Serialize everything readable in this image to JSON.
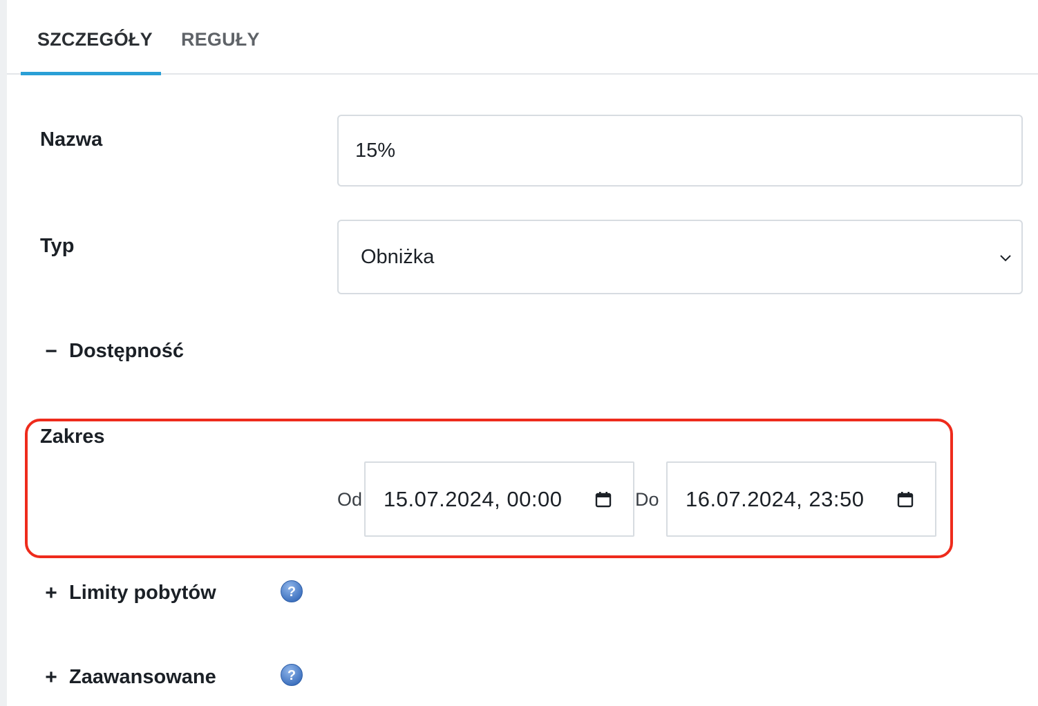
{
  "tabs": [
    {
      "label": "SZCZEGÓŁY",
      "active": true
    },
    {
      "label": "REGUŁY",
      "active": false
    }
  ],
  "form": {
    "name": {
      "label": "Nazwa",
      "value": "15%"
    },
    "type": {
      "label": "Typ",
      "value": "Obniżka"
    },
    "availability": {
      "toggle": "−",
      "title": "Dostępność",
      "expanded": true
    },
    "range": {
      "label": "Zakres",
      "from_label": "Od",
      "from_value": "15.07.2024, 00:00",
      "to_label": "Do",
      "to_value": "16.07.2024, 23:50"
    },
    "stay_limits": {
      "toggle": "+",
      "title": "Limity pobytów",
      "expanded": false
    },
    "advanced": {
      "toggle": "+",
      "title": "Zaawansowane",
      "expanded": false
    }
  },
  "colors": {
    "accent": "#2a9fd6",
    "highlight": "#ee2b1c",
    "help_icon": "#4a80c8"
  },
  "icons": [
    "chevron-down-icon",
    "calendar-icon",
    "help-icon"
  ]
}
